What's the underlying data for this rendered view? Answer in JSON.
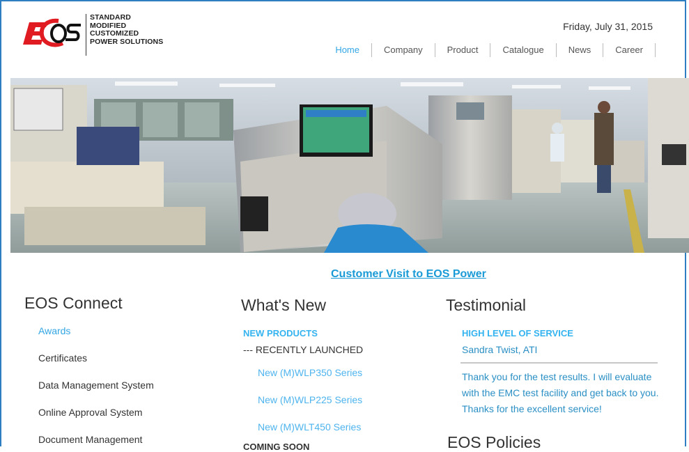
{
  "logo": {
    "lines": [
      "STANDARD",
      "MODIFIED",
      "CUSTOMIZED",
      "POWER SOLUTIONS"
    ],
    "mark_letters": "EOS"
  },
  "header": {
    "date": "Friday, July 31, 2015"
  },
  "nav": {
    "items": [
      "Home",
      "Company",
      "Product",
      "Catalogue",
      "News",
      "Career"
    ],
    "active": "Home"
  },
  "hero": {
    "alt": "Factory production floor"
  },
  "headline": "Customer Visit to EOS Power",
  "connect": {
    "title": "EOS Connect",
    "items": [
      "Awards",
      "Certificates",
      "Data Management System",
      "Online Approval System",
      "Document Management"
    ]
  },
  "whats_new": {
    "title": "What's New",
    "section_head": "NEW PRODUCTS",
    "subhead": "--- RECENTLY LAUNCHED",
    "links": [
      "New (M)WLP350 Series",
      "New (M)WLP225 Series",
      "New (M)WLT450 Series"
    ],
    "coming_soon": "COMING SOON"
  },
  "testimonial": {
    "title": "Testimonial",
    "head": "HIGH LEVEL OF SERVICE",
    "name": "Sandra Twist, ATI",
    "quote": "Thank you for the test results. I will evaluate with the EMC test facility and get back to you. Thanks for the excellent service!",
    "next_title": "EOS Policies"
  },
  "colors": {
    "accent": "#33a6e5",
    "logo_red": "#e11b22",
    "frame": "#2d7fc1"
  }
}
